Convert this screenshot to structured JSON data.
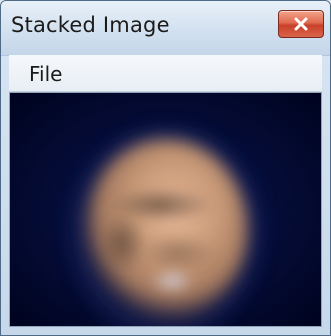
{
  "window": {
    "title": "Stacked Image"
  },
  "menu": {
    "items": [
      {
        "label": "File"
      }
    ]
  },
  "icons": {
    "close": "close-icon"
  },
  "colors": {
    "image_background": "#00052a",
    "planet_tone": "#c99a78"
  }
}
